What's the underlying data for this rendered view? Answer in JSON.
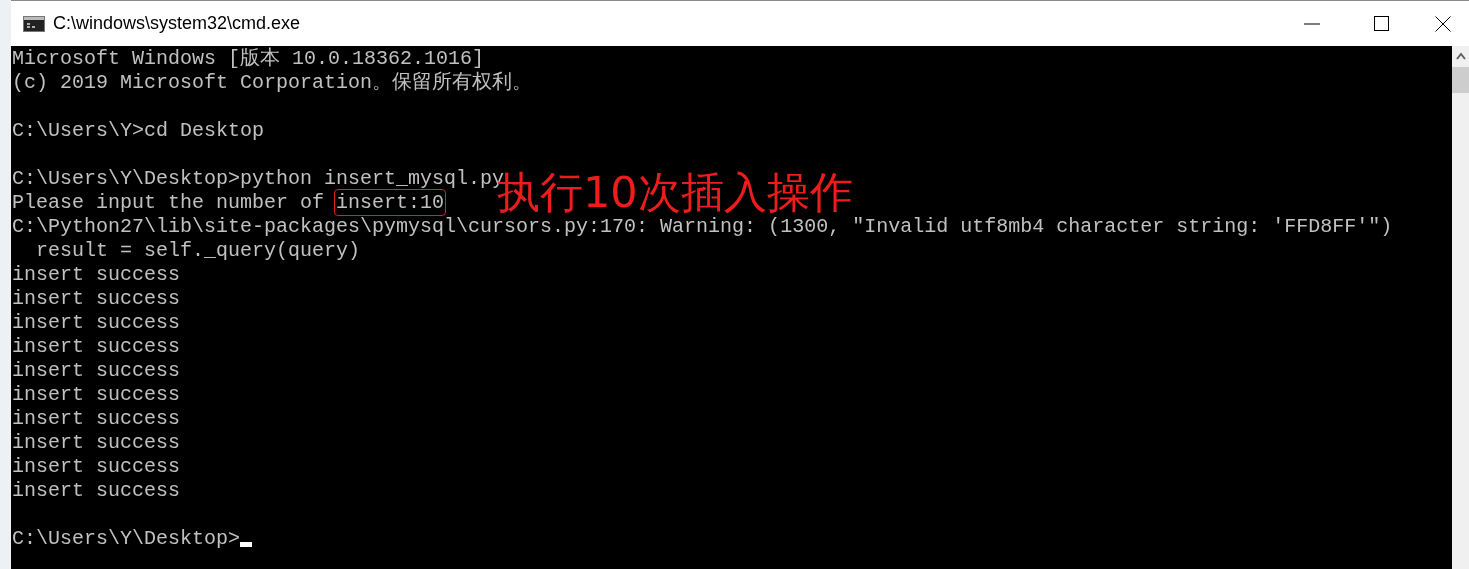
{
  "window": {
    "title": "C:\\windows\\system32\\cmd.exe"
  },
  "console": {
    "lines": [
      {
        "kind": "text",
        "text": "Microsoft Windows [版本 10.0.18362.1016]"
      },
      {
        "kind": "text",
        "text": "(c) 2019 Microsoft Corporation。保留所有权利。"
      },
      {
        "kind": "blank"
      },
      {
        "kind": "text",
        "text": "C:\\Users\\Y>cd Desktop"
      },
      {
        "kind": "blank"
      },
      {
        "kind": "text",
        "text": "C:\\Users\\Y\\Desktop>python insert_mysql.py"
      },
      {
        "kind": "highlight",
        "text": "Please input the number of ",
        "highlighted": "insert:10"
      },
      {
        "kind": "text",
        "text": "C:\\Python27\\lib\\site-packages\\pymysql\\cursors.py:170: Warning: (1300, ″Invalid utf8mb4 character string: 'FFD8FF'″)"
      },
      {
        "kind": "text",
        "text": "  result = self._query(query)"
      },
      {
        "kind": "text",
        "text": "insert success"
      },
      {
        "kind": "text",
        "text": "insert success"
      },
      {
        "kind": "text",
        "text": "insert success"
      },
      {
        "kind": "text",
        "text": "insert success"
      },
      {
        "kind": "text",
        "text": "insert success"
      },
      {
        "kind": "text",
        "text": "insert success"
      },
      {
        "kind": "text",
        "text": "insert success"
      },
      {
        "kind": "text",
        "text": "insert success"
      },
      {
        "kind": "text",
        "text": "insert success"
      },
      {
        "kind": "text",
        "text": "insert success"
      },
      {
        "kind": "blank"
      },
      {
        "kind": "text",
        "text": "C:\\Users\\Y\\Desktop>",
        "cursor": true
      }
    ]
  },
  "annotation": {
    "text": "执行10次插入操作"
  }
}
